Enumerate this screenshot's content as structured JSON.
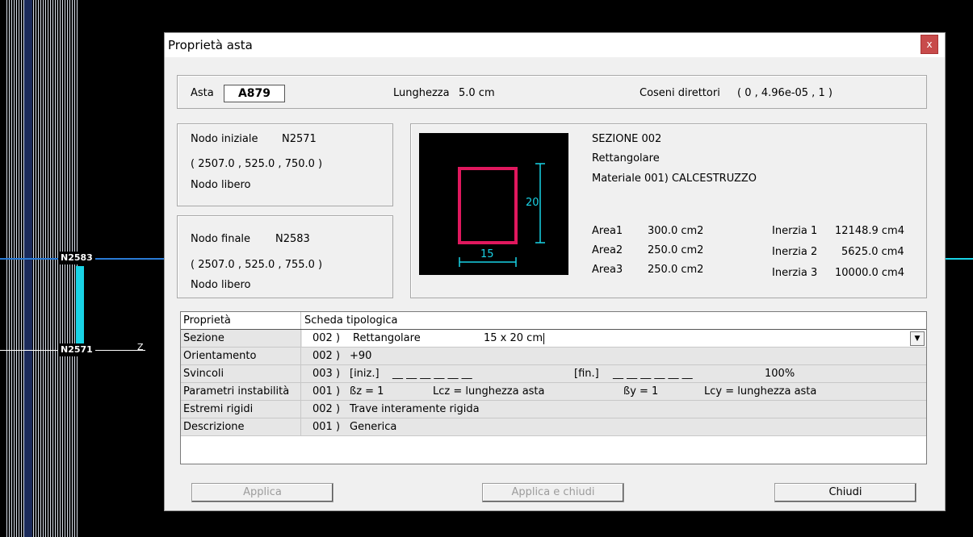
{
  "cad": {
    "node_top": "N2583",
    "node_bottom": "N2571",
    "axis_label": "Z"
  },
  "dialog": {
    "title": "Proprietà asta",
    "close_glyph": "x",
    "asta_label": "Asta",
    "asta_value": "A879",
    "lunghezza_label": "Lunghezza",
    "lunghezza_value": "5.0 cm",
    "coseni_label": "Coseni direttori",
    "coseni_value": "( 0 , 4.96e-05 , 1 )",
    "nodo_iniziale": {
      "label": "Nodo iniziale",
      "id": "N2571",
      "coords": "( 2507.0 ,  525.0 ,  750.0 )",
      "state": "Nodo libero"
    },
    "nodo_finale": {
      "label": "Nodo finale",
      "id": "N2583",
      "coords": "( 2507.0 ,  525.0 ,  755.0 )",
      "state": "Nodo libero"
    },
    "section": {
      "heading": "SEZIONE  002",
      "shape": "Rettangolare",
      "material": "Materiale   001)  CALCESTRUZZO",
      "dim_width": "15",
      "dim_height": "20",
      "areas": [
        {
          "label": "Area1",
          "value": "300.0  cm2"
        },
        {
          "label": "Area2",
          "value": "250.0  cm2"
        },
        {
          "label": "Area3",
          "value": "250.0  cm2"
        }
      ],
      "inertias": [
        {
          "label": "Inerzia 1",
          "value": "12148.9  cm4"
        },
        {
          "label": "Inerzia 2",
          "value": "5625.0  cm4"
        },
        {
          "label": "Inerzia 3",
          "value": "10000.0  cm4"
        }
      ]
    },
    "table": {
      "header_left": "Proprietà",
      "header_right": "Scheda tipologica",
      "rows": [
        {
          "label": "Sezione",
          "code": "002 )",
          "text": "Rettangolare",
          "extra": "15  x 20  cm"
        },
        {
          "label": "Orientamento",
          "code": "002 )",
          "text": "+90"
        },
        {
          "label": "Svincoli",
          "code": "003 )",
          "text": "[iniz.]",
          "dashes1": "__   __   __   __   __   __",
          "fin": "[fin.]",
          "dashes2": "__   __   __   __   __   __",
          "pct": "100%"
        },
        {
          "label": "Parametri instabilità",
          "code": "001 )",
          "text": "ßz =     1",
          "lcz": "Lcz = lunghezza asta",
          "by": "ßy =     1",
          "lcy": "Lcy = lunghezza asta"
        },
        {
          "label": "Estremi rigidi",
          "code": "002 )",
          "text": "Trave interamente rigida"
        },
        {
          "label": "Descrizione",
          "code": "001 )",
          "text": "Generica"
        }
      ]
    },
    "buttons": {
      "applica": "Applica",
      "applica_chiudi": "Applica e chiudi",
      "chiudi": "Chiudi"
    }
  }
}
